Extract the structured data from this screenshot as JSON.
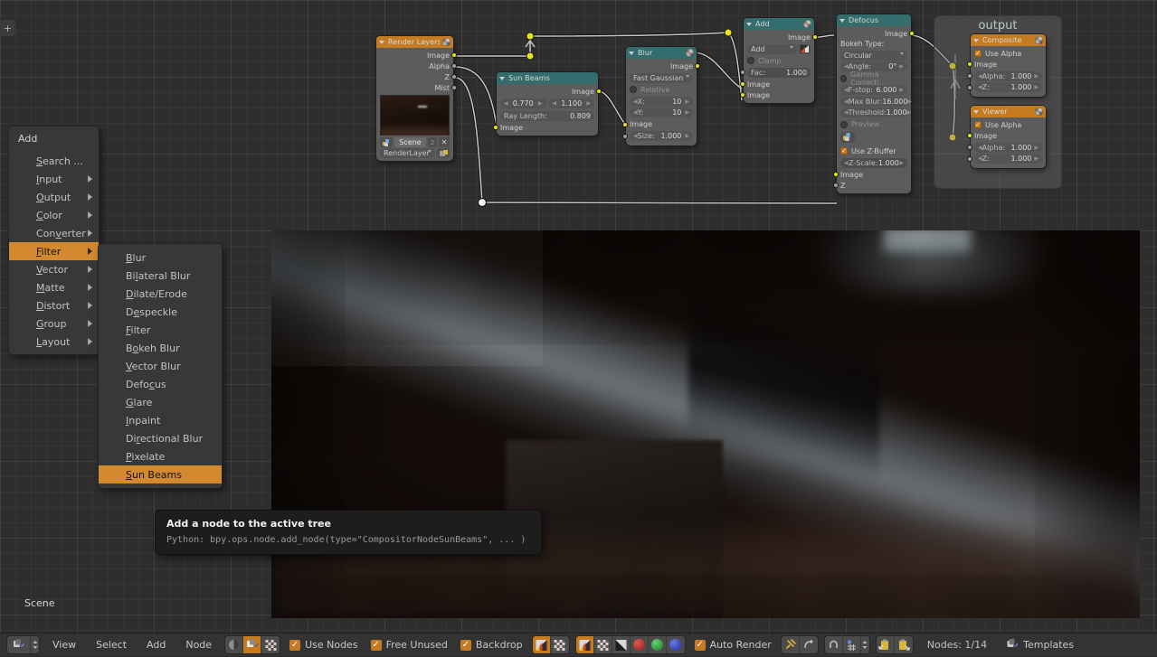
{
  "app": {
    "editor": "Node Editor",
    "scene_label": "Scene",
    "plus_tab": "+"
  },
  "add_menu": {
    "title": "Add",
    "items": [
      {
        "label": "Search ...",
        "submenu": false
      },
      {
        "label": "Input",
        "submenu": true
      },
      {
        "label": "Output",
        "submenu": true
      },
      {
        "label": "Color",
        "submenu": true
      },
      {
        "label": "Converter",
        "submenu": true
      },
      {
        "label": "Filter",
        "submenu": true,
        "selected": true
      },
      {
        "label": "Vector",
        "submenu": true
      },
      {
        "label": "Matte",
        "submenu": true
      },
      {
        "label": "Distort",
        "submenu": true
      },
      {
        "label": "Group",
        "submenu": true
      },
      {
        "label": "Layout",
        "submenu": true
      }
    ]
  },
  "filter_submenu": {
    "items": [
      {
        "label": "Blur"
      },
      {
        "label": "Bilateral Blur"
      },
      {
        "label": "Dilate/Erode"
      },
      {
        "label": "Despeckle"
      },
      {
        "label": "Filter"
      },
      {
        "label": "Bokeh Blur"
      },
      {
        "label": "Vector Blur"
      },
      {
        "label": "Defocus"
      },
      {
        "label": "Glare"
      },
      {
        "label": "Inpaint"
      },
      {
        "label": "Directional Blur"
      },
      {
        "label": "Pixelate"
      },
      {
        "label": "Sun Beams",
        "selected": true
      }
    ]
  },
  "tooltip": {
    "title": "Add a node to the active tree",
    "python": "Python: bpy.ops.node.add_node(type=\"CompositorNodeSunBeams\", ... )"
  },
  "nodes": {
    "render_layers": {
      "title": "Render Layers",
      "outputs": [
        "Image",
        "Alpha",
        "Z",
        "Mist"
      ],
      "scene": "Scene",
      "scene_users": "2",
      "layer": "RenderLayer"
    },
    "sun_beams": {
      "title": "Sun Beams",
      "outputs": [
        "Image"
      ],
      "source_x": "0.770",
      "source_y": "1.100",
      "ray_length_label": "Ray Length:",
      "ray_length": "0.809",
      "inputs": [
        "Image"
      ]
    },
    "blur": {
      "title": "Blur",
      "outputs": [
        "Image"
      ],
      "filter_type": "Fast Gaussian",
      "relative": "Relative",
      "x_label": "X:",
      "x_value": "10",
      "y_label": "Y:",
      "y_value": "10",
      "inputs": [
        "Image"
      ],
      "size_label": "Size:",
      "size_value": "1.000"
    },
    "add": {
      "title": "Add",
      "outputs": [
        "Image"
      ],
      "blend_mode": "Add",
      "clamp": "Clamp",
      "fac_label": "Fac:",
      "fac_value": "1.000",
      "inputs": [
        "Image",
        "Image"
      ]
    },
    "defocus": {
      "title": "Defocus",
      "outputs": [
        "Image"
      ],
      "bokeh_type_label": "Bokeh Type:",
      "bokeh_type": "Circular",
      "angle_label": "Angle:",
      "angle_value": "0°",
      "gamma_correction": "Gamma Correcti...",
      "fstop_label": "F-stop:",
      "fstop_value": "6.000",
      "maxblur_label": "Max Blur:",
      "maxblur_value": "16.000",
      "threshold_label": "Threshold:",
      "threshold_value": "1.000",
      "preview": "Preview",
      "use_zbuffer": "Use Z-Buffer",
      "zscale_label": "Z-Scale:",
      "zscale_value": "1.000",
      "inputs": [
        "Image",
        "Z"
      ]
    },
    "composite": {
      "title": "Composite",
      "use_alpha": "Use Alpha",
      "inputs": [
        "Image"
      ],
      "alpha_label": "Alpha:",
      "alpha_value": "1.000",
      "z_label": "Z:",
      "z_value": "1.000"
    },
    "viewer": {
      "title": "Viewer",
      "use_alpha": "Use Alpha",
      "inputs": [
        "Image"
      ],
      "alpha_label": "Alpha:",
      "alpha_value": "1.000",
      "z_label": "Z:",
      "z_value": "1.000"
    },
    "frame": {
      "label": "output"
    }
  },
  "bottom_bar": {
    "menus": [
      "View",
      "Select",
      "Add",
      "Node"
    ],
    "tree_type_icons": [
      "shader-tree-icon",
      "compositor-tree-icon",
      "texture-tree-icon"
    ],
    "use_nodes": "Use Nodes",
    "free_unused": "Free Unused",
    "backdrop": "Backdrop",
    "channel_icons": [
      "rgba-channel-icon",
      "alpha-channel-icon",
      "z-channel-icon"
    ],
    "color_dots": [
      "#b83333",
      "#33a84a",
      "#3a47c0"
    ],
    "auto_render": "Auto Render",
    "node_count": "Nodes: 1/14",
    "templates": "Templates"
  }
}
